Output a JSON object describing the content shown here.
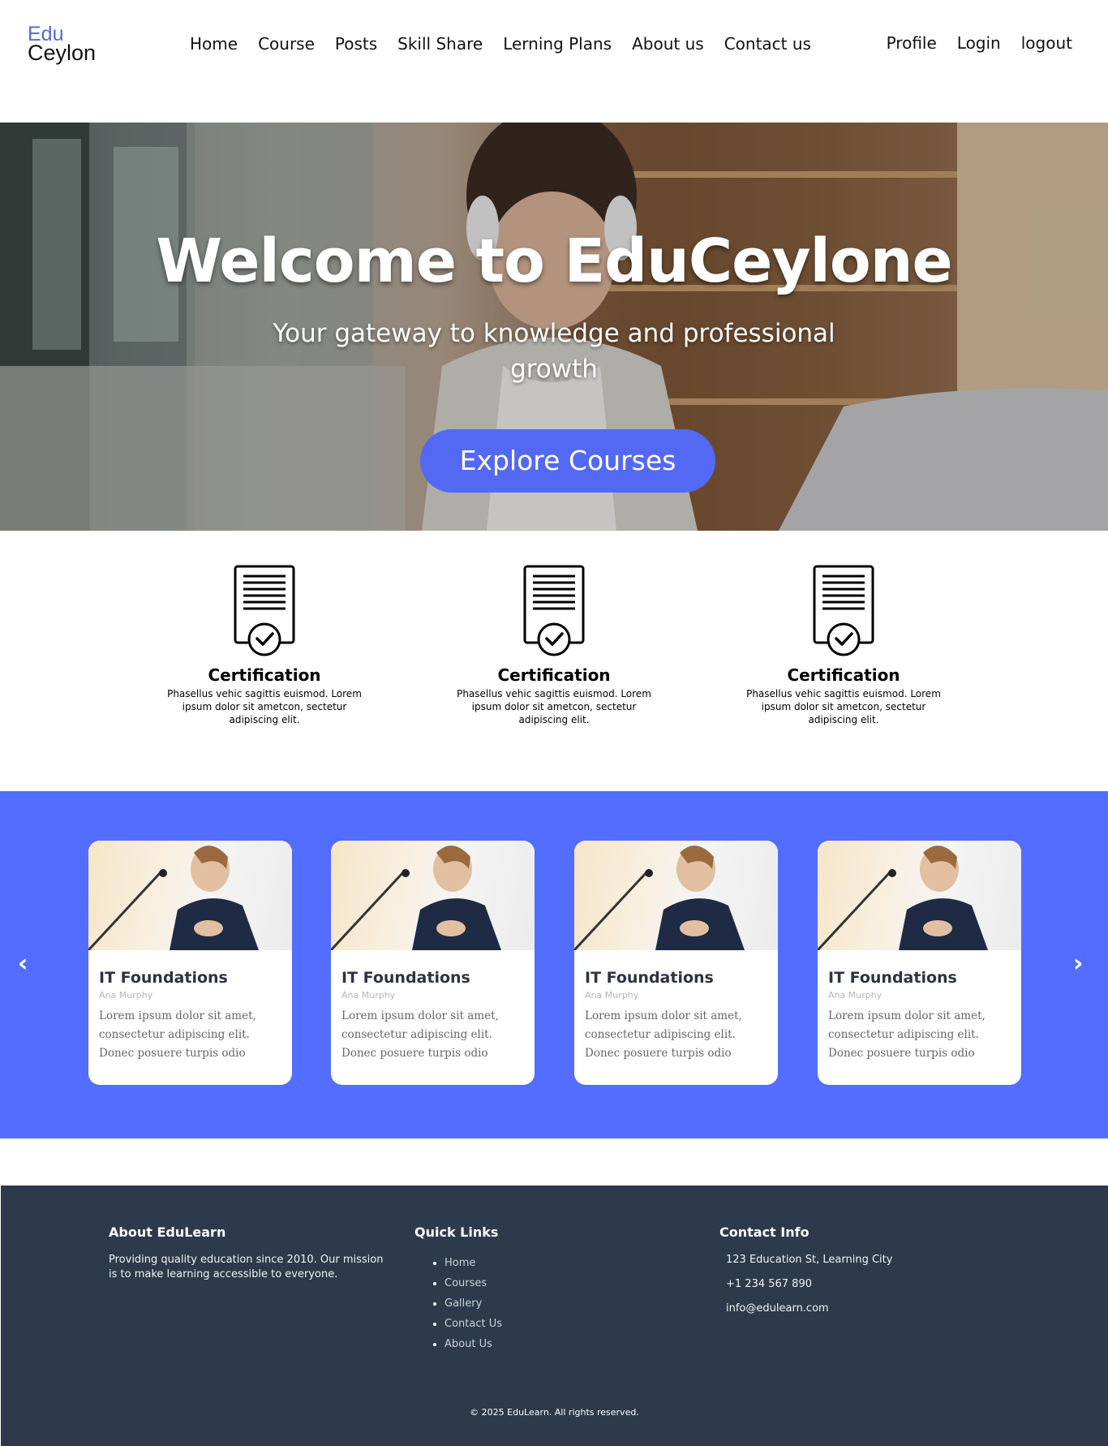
{
  "brand": {
    "line1": "Edu",
    "line2": "Ceylon",
    "accent": "#5469d4"
  },
  "nav": {
    "links": [
      "Home",
      "Course",
      "Posts",
      "Skill Share",
      "Lerning Plans",
      "About us",
      "Contact us"
    ],
    "right": [
      "Profile",
      "Login",
      "logout"
    ]
  },
  "hero": {
    "title": "Welcome to EduCeylone",
    "subtitle": "Your gateway to knowledge and professional growth",
    "button": "Explore Courses",
    "button_color": "#5469f3"
  },
  "features": [
    {
      "icon": "certificate-icon",
      "title": "Certification",
      "text": "Phasellus vehic sagittis euismod. Lorem ipsum dolor sit ametcon, sectetur adipiscing elit."
    },
    {
      "icon": "certificate-icon",
      "title": "Certification",
      "text": "Phasellus vehic sagittis euismod. Lorem ipsum dolor sit ametcon, sectetur adipiscing elit."
    },
    {
      "icon": "certificate-icon",
      "title": "Certification",
      "text": "Phasellus vehic sagittis euismod. Lorem ipsum dolor sit ametcon, sectetur adipiscing elit."
    }
  ],
  "courses": {
    "background": "#536dfe",
    "prev_icon": "chevron-left-icon",
    "next_icon": "chevron-right-icon",
    "prev_glyph": "‹",
    "next_glyph": "›",
    "cards": [
      {
        "title": "IT Foundations",
        "author": "Ana Murphy",
        "description": "Lorem ipsum dolor sit amet, consectetur adipiscing elit. Donec posuere turpis odio"
      },
      {
        "title": "IT Foundations",
        "author": "Ana Murphy",
        "description": "Lorem ipsum dolor sit amet, consectetur adipiscing elit. Donec posuere turpis odio"
      },
      {
        "title": "IT Foundations",
        "author": "Ana Murphy",
        "description": "Lorem ipsum dolor sit amet, consectetur adipiscing elit. Donec posuere turpis odio"
      },
      {
        "title": "IT Foundations",
        "author": "Ana Murphy",
        "description": "Lorem ipsum dolor sit amet, consectetur adipiscing elit. Donec posuere turpis odio"
      }
    ]
  },
  "footer": {
    "background": "#2d3a4b",
    "about": {
      "heading": "About EduLearn",
      "text": "Providing quality education since 2010. Our mission is to make learning accessible to everyone."
    },
    "quick_links": {
      "heading": "Quick Links",
      "items": [
        "Home",
        "Courses",
        "Gallery",
        "Contact Us",
        "About Us"
      ]
    },
    "contact": {
      "heading": "Contact Info",
      "address": "123 Education St, Learning City",
      "phone": "+1 234 567 890",
      "email": "info@edulearn.com"
    },
    "copyright": "© 2025 EduLearn. All rights reserved."
  }
}
